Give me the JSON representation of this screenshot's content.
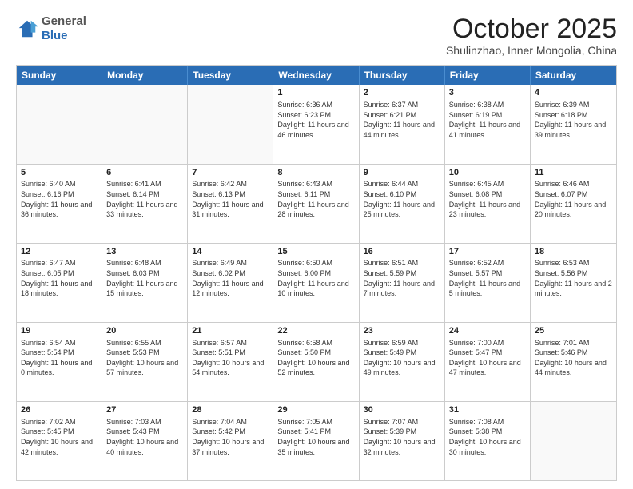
{
  "header": {
    "logo_general": "General",
    "logo_blue": "Blue",
    "month": "October 2025",
    "location": "Shulinzhao, Inner Mongolia, China"
  },
  "weekdays": [
    "Sunday",
    "Monday",
    "Tuesday",
    "Wednesday",
    "Thursday",
    "Friday",
    "Saturday"
  ],
  "rows": [
    [
      {
        "day": "",
        "text": "",
        "empty": true
      },
      {
        "day": "",
        "text": "",
        "empty": true
      },
      {
        "day": "",
        "text": "",
        "empty": true
      },
      {
        "day": "1",
        "text": "Sunrise: 6:36 AM\nSunset: 6:23 PM\nDaylight: 11 hours and 46 minutes.",
        "empty": false
      },
      {
        "day": "2",
        "text": "Sunrise: 6:37 AM\nSunset: 6:21 PM\nDaylight: 11 hours and 44 minutes.",
        "empty": false
      },
      {
        "day": "3",
        "text": "Sunrise: 6:38 AM\nSunset: 6:19 PM\nDaylight: 11 hours and 41 minutes.",
        "empty": false
      },
      {
        "day": "4",
        "text": "Sunrise: 6:39 AM\nSunset: 6:18 PM\nDaylight: 11 hours and 39 minutes.",
        "empty": false
      }
    ],
    [
      {
        "day": "5",
        "text": "Sunrise: 6:40 AM\nSunset: 6:16 PM\nDaylight: 11 hours and 36 minutes.",
        "empty": false
      },
      {
        "day": "6",
        "text": "Sunrise: 6:41 AM\nSunset: 6:14 PM\nDaylight: 11 hours and 33 minutes.",
        "empty": false
      },
      {
        "day": "7",
        "text": "Sunrise: 6:42 AM\nSunset: 6:13 PM\nDaylight: 11 hours and 31 minutes.",
        "empty": false
      },
      {
        "day": "8",
        "text": "Sunrise: 6:43 AM\nSunset: 6:11 PM\nDaylight: 11 hours and 28 minutes.",
        "empty": false
      },
      {
        "day": "9",
        "text": "Sunrise: 6:44 AM\nSunset: 6:10 PM\nDaylight: 11 hours and 25 minutes.",
        "empty": false
      },
      {
        "day": "10",
        "text": "Sunrise: 6:45 AM\nSunset: 6:08 PM\nDaylight: 11 hours and 23 minutes.",
        "empty": false
      },
      {
        "day": "11",
        "text": "Sunrise: 6:46 AM\nSunset: 6:07 PM\nDaylight: 11 hours and 20 minutes.",
        "empty": false
      }
    ],
    [
      {
        "day": "12",
        "text": "Sunrise: 6:47 AM\nSunset: 6:05 PM\nDaylight: 11 hours and 18 minutes.",
        "empty": false
      },
      {
        "day": "13",
        "text": "Sunrise: 6:48 AM\nSunset: 6:03 PM\nDaylight: 11 hours and 15 minutes.",
        "empty": false
      },
      {
        "day": "14",
        "text": "Sunrise: 6:49 AM\nSunset: 6:02 PM\nDaylight: 11 hours and 12 minutes.",
        "empty": false
      },
      {
        "day": "15",
        "text": "Sunrise: 6:50 AM\nSunset: 6:00 PM\nDaylight: 11 hours and 10 minutes.",
        "empty": false
      },
      {
        "day": "16",
        "text": "Sunrise: 6:51 AM\nSunset: 5:59 PM\nDaylight: 11 hours and 7 minutes.",
        "empty": false
      },
      {
        "day": "17",
        "text": "Sunrise: 6:52 AM\nSunset: 5:57 PM\nDaylight: 11 hours and 5 minutes.",
        "empty": false
      },
      {
        "day": "18",
        "text": "Sunrise: 6:53 AM\nSunset: 5:56 PM\nDaylight: 11 hours and 2 minutes.",
        "empty": false
      }
    ],
    [
      {
        "day": "19",
        "text": "Sunrise: 6:54 AM\nSunset: 5:54 PM\nDaylight: 11 hours and 0 minutes.",
        "empty": false
      },
      {
        "day": "20",
        "text": "Sunrise: 6:55 AM\nSunset: 5:53 PM\nDaylight: 10 hours and 57 minutes.",
        "empty": false
      },
      {
        "day": "21",
        "text": "Sunrise: 6:57 AM\nSunset: 5:51 PM\nDaylight: 10 hours and 54 minutes.",
        "empty": false
      },
      {
        "day": "22",
        "text": "Sunrise: 6:58 AM\nSunset: 5:50 PM\nDaylight: 10 hours and 52 minutes.",
        "empty": false
      },
      {
        "day": "23",
        "text": "Sunrise: 6:59 AM\nSunset: 5:49 PM\nDaylight: 10 hours and 49 minutes.",
        "empty": false
      },
      {
        "day": "24",
        "text": "Sunrise: 7:00 AM\nSunset: 5:47 PM\nDaylight: 10 hours and 47 minutes.",
        "empty": false
      },
      {
        "day": "25",
        "text": "Sunrise: 7:01 AM\nSunset: 5:46 PM\nDaylight: 10 hours and 44 minutes.",
        "empty": false
      }
    ],
    [
      {
        "day": "26",
        "text": "Sunrise: 7:02 AM\nSunset: 5:45 PM\nDaylight: 10 hours and 42 minutes.",
        "empty": false
      },
      {
        "day": "27",
        "text": "Sunrise: 7:03 AM\nSunset: 5:43 PM\nDaylight: 10 hours and 40 minutes.",
        "empty": false
      },
      {
        "day": "28",
        "text": "Sunrise: 7:04 AM\nSunset: 5:42 PM\nDaylight: 10 hours and 37 minutes.",
        "empty": false
      },
      {
        "day": "29",
        "text": "Sunrise: 7:05 AM\nSunset: 5:41 PM\nDaylight: 10 hours and 35 minutes.",
        "empty": false
      },
      {
        "day": "30",
        "text": "Sunrise: 7:07 AM\nSunset: 5:39 PM\nDaylight: 10 hours and 32 minutes.",
        "empty": false
      },
      {
        "day": "31",
        "text": "Sunrise: 7:08 AM\nSunset: 5:38 PM\nDaylight: 10 hours and 30 minutes.",
        "empty": false
      },
      {
        "day": "",
        "text": "",
        "empty": true
      }
    ]
  ]
}
